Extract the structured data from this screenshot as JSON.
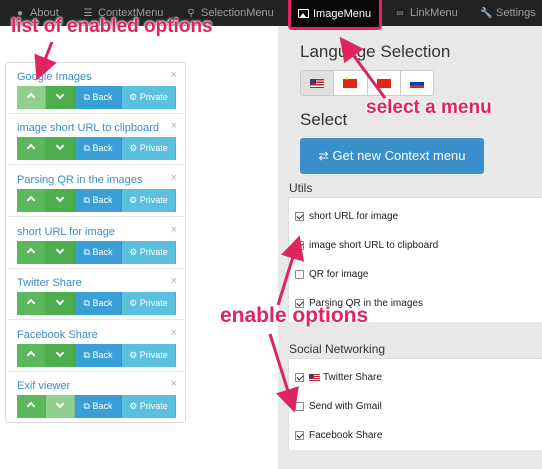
{
  "navbar": {
    "items": [
      {
        "label": "About",
        "icon": "info-icon"
      },
      {
        "label": "ContextMenu",
        "icon": "list-icon"
      },
      {
        "label": "SelectionMenu",
        "icon": "search-icon"
      },
      {
        "label": "ImageMenu",
        "icon": "image-icon",
        "active": true
      },
      {
        "label": "LinkMenu",
        "icon": "link-icon"
      },
      {
        "label": "Settings",
        "icon": "wrench-icon"
      }
    ]
  },
  "enabled_options": [
    {
      "title": "Google Images"
    },
    {
      "title": "image short URL to clipboard"
    },
    {
      "title": "Parsing QR in the images"
    },
    {
      "title": "short URL for image"
    },
    {
      "title": "Twitter Share"
    },
    {
      "title": "Facebook Share"
    },
    {
      "title": "Exif viewer"
    }
  ],
  "option_buttons": {
    "back": "Back",
    "private": "Private",
    "close": "×"
  },
  "language": {
    "title": "Language Selection",
    "flags": [
      "us-flag-icon",
      "cn-flag-icon",
      "cn-flag-icon",
      "ru-flag-icon"
    ],
    "selected_index": 0
  },
  "select": {
    "title": "Select",
    "button": "Get new Context menu"
  },
  "utils": {
    "title": "Utils",
    "items": [
      {
        "label": "short URL for image",
        "checked": true
      },
      {
        "label": "image short URL to clipboard",
        "checked": true
      },
      {
        "label": "QR for image",
        "checked": false
      },
      {
        "label": "Parsing QR in the images",
        "checked": true
      }
    ]
  },
  "social": {
    "title": "Social Networking",
    "items": [
      {
        "label": "Twitter Share",
        "checked": true
      },
      {
        "label": "Send with Gmail",
        "checked": false
      },
      {
        "label": "Facebook Share",
        "checked": true
      }
    ]
  },
  "annotations": {
    "list": "list of enabled options",
    "menu": "select a menu",
    "enable": "enable options"
  },
  "colors": {
    "annotation": "#e0245e",
    "primary": "#3a8ec9",
    "success": "#5cb85c",
    "info": "#5bc0de",
    "navbar": "#222222"
  }
}
